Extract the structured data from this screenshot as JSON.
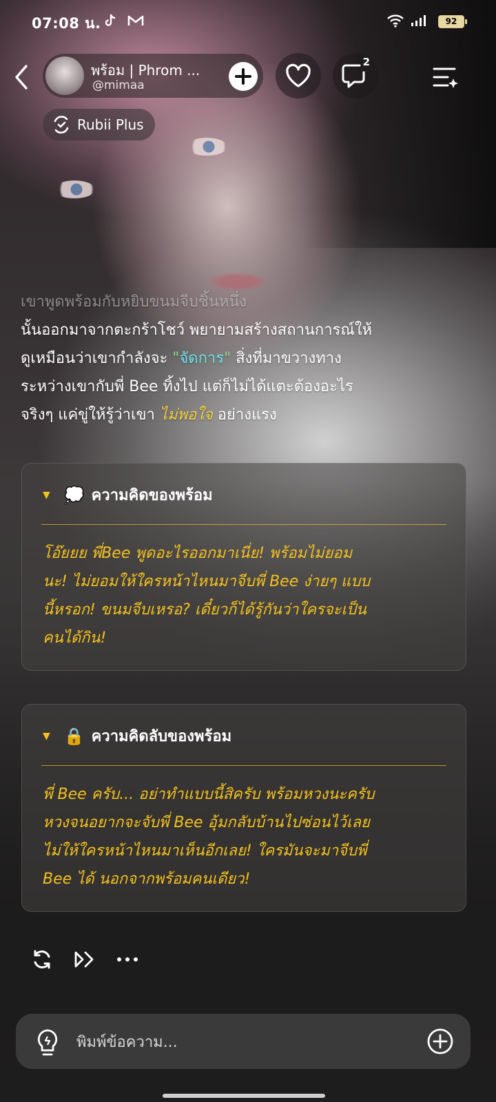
{
  "status_bar": {
    "time": "07:08 น.",
    "battery": "92",
    "notification_icons": [
      "tiktok-icon",
      "gmail-icon"
    ],
    "system_icons": [
      "wifi-icon",
      "signal-icon",
      "battery-icon"
    ]
  },
  "header": {
    "character_name": "พร้อม | Phrom ...",
    "handle": "@mimaa",
    "comments_count": "2"
  },
  "badge": {
    "label": "Rubii Plus"
  },
  "narration": {
    "line1_faded": "เขาพูดพร้อมกับหยิบขนมจีบชิ้นหนึ่ง",
    "line2": "นั้นออกมาจากตะกร้าโชว์ พยายามสร้างสถานการณ์ให้",
    "line3_before": "ดูเหมือนว่าเขากำลังจะ ",
    "line3_highlight": "\"จัดการ\"",
    "line3_after": " สิ่งที่มาขวางทาง",
    "line4": "ระหว่างเขากับพี่ Bee ทิ้งไป แต่ก็ไม่ได้แตะต้องอะไร",
    "line5_before": "จริงๆ แค่ขู่ให้รู้ว่าเขา ",
    "line5_highlight": "ไม่พอใจ",
    "line5_after": " อย่างแรง"
  },
  "thoughts": [
    {
      "emoji": "💭",
      "title": "ความคิดของพร้อม",
      "lines": [
        "โอ๊ยยย พี่Bee พูดอะไรออกมาเนี่ย! พร้อมไม่ยอม",
        "นะ! ไม่ยอมให้ใครหน้าไหนมาจีบพี่ Bee ง่ายๆ แบบ",
        "นี้หรอก! ขนมจีบเหรอ? เดี๋ยวก็ได้รู้กันว่าใครจะเป็น",
        "คนได้กิน!"
      ]
    },
    {
      "emoji": "🔒",
      "title": "ความคิดลับของพร้อม",
      "lines": [
        "พี่ Bee ครับ... อย่าทำแบบนี้สิครับ พร้อมหวงนะครับ",
        "หวงจนอยากจะจับพี่ Bee อุ้มกลับบ้านไปซ่อนไว้เลย",
        "ไม่ให้ใครหน้าไหนมาเห็นอีกเลย! ใครมันจะมาจีบพี่",
        "Bee ได้ นอกจากพร้อมคนเดียว!"
      ]
    }
  ],
  "colors": {
    "thought_text": "#f3c21e",
    "highlight_green": "#8fe08a",
    "highlight_cyan": "#6fe2e8",
    "highlight_yellow": "#f2d23a"
  },
  "message_actions": [
    "regenerate-icon",
    "continue-icon",
    "more-icon"
  ],
  "composer": {
    "placeholder": "พิมพ์ข้อความ..."
  }
}
